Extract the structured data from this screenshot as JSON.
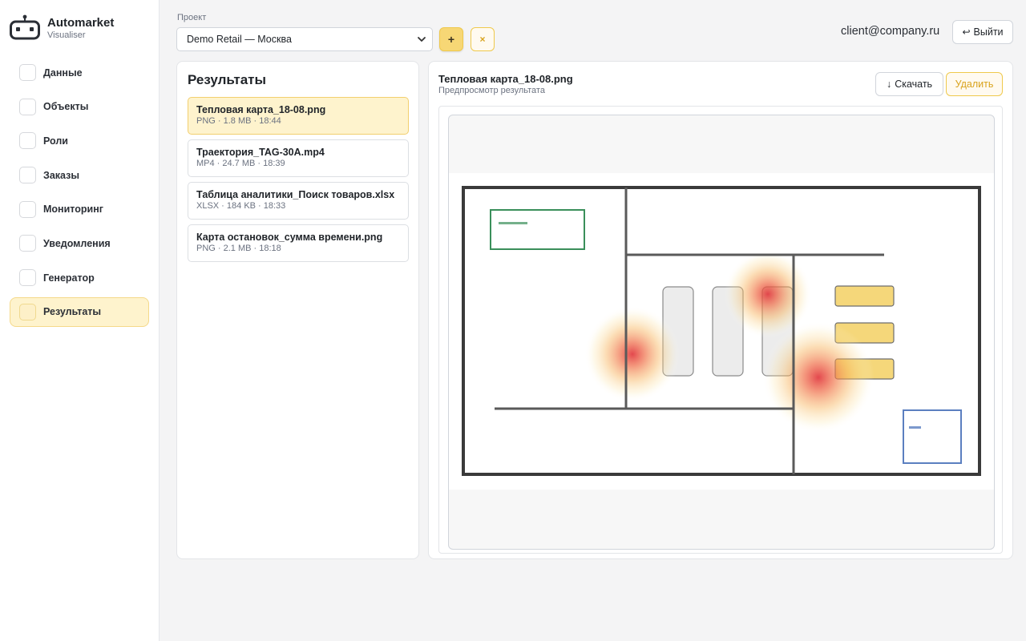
{
  "app": {
    "name": "Automarket",
    "subtitle": "Visualiser"
  },
  "sidebar": {
    "items": [
      {
        "label": "Данные",
        "active": false
      },
      {
        "label": "Объекты",
        "active": false
      },
      {
        "label": "Роли",
        "active": false
      },
      {
        "label": "Заказы",
        "active": false
      },
      {
        "label": "Мониторинг",
        "active": false
      },
      {
        "label": "Уведомления",
        "active": false
      },
      {
        "label": "Генератор",
        "active": false
      },
      {
        "label": "Результаты",
        "active": true
      }
    ]
  },
  "header": {
    "project_label": "Проект",
    "project_value": "Demo Retail — Москва",
    "add_label": "+",
    "close_label": "×",
    "user_email": "client@company.ru",
    "logout_label": "Выйти"
  },
  "results": {
    "title": "Результаты",
    "files": [
      {
        "name": "Тепловая карта_18-08.png",
        "meta": "PNG · 1.8 MB · 18:44",
        "active": true
      },
      {
        "name": "Траектория_TAG-30A.mp4",
        "meta": "MP4 · 24.7 MB · 18:39",
        "active": false
      },
      {
        "name": "Таблица аналитики_Поиск товаров.xlsx",
        "meta": "XLSX · 184 KB · 18:33",
        "active": false
      },
      {
        "name": "Карта остановок_сумма времени.png",
        "meta": "PNG · 2.1 MB · 18:18",
        "active": false
      }
    ]
  },
  "preview": {
    "title": "Тепловая карта_18-08.png",
    "subtitle": "Предпросмотр результата",
    "download_label": "Скачать",
    "delete_label": "Удалить"
  },
  "colors": {
    "accent": "#f7d775",
    "accent_border": "#efc94c",
    "active_bg": "#fef3cd",
    "wall": "#3a3a3a",
    "entrance_zone": "#3a8f5a",
    "exit_zone": "#5b7fc0",
    "shelf_fill": "#f5d77a"
  }
}
